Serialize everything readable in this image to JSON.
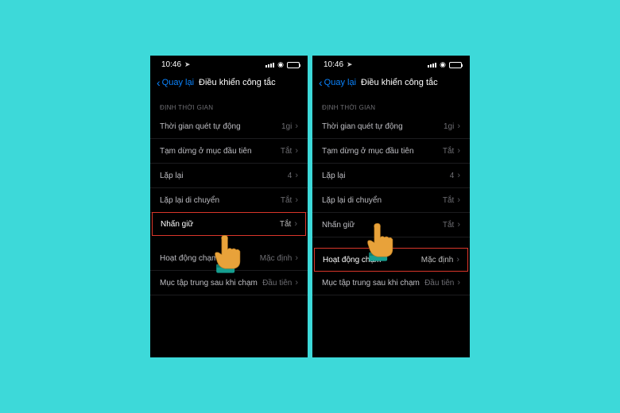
{
  "status": {
    "time": "10:46",
    "location_icon": "➤"
  },
  "nav": {
    "back_label": "Quay lại",
    "title": "Điều khiển công tắc"
  },
  "section_timing": "ĐỊNH THỜI GIAN",
  "rows": {
    "auto_scan": {
      "label": "Thời gian quét tự động",
      "value": "1gi"
    },
    "pause_first": {
      "label": "Tạm dừng ở mục đầu tiên",
      "value": "Tắt"
    },
    "repeat": {
      "label": "Lặp lại",
      "value": "4"
    },
    "repeat_move": {
      "label": "Lặp lại di chuyển",
      "value": "Tắt"
    },
    "press_hold": {
      "label": "Nhấn giữ",
      "value": "Tắt"
    },
    "tap_behavior": {
      "label": "Hoạt động chạm",
      "value": "Mặc định"
    },
    "focus_after_tap": {
      "label": "Mục tập trung sau khi chạm",
      "value": "Đầu tiên"
    }
  }
}
